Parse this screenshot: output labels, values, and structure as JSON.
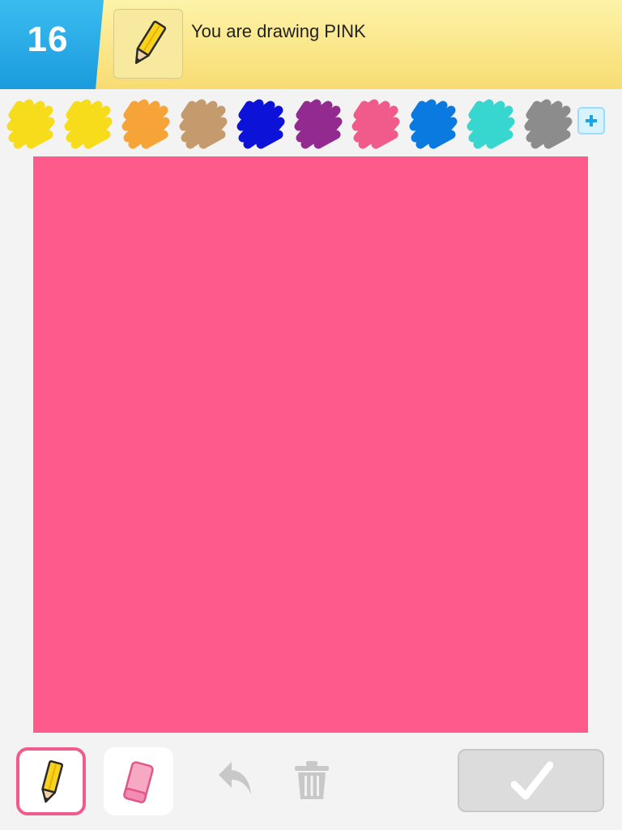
{
  "header": {
    "round_number": "16",
    "prompt": "You are drawing PINK",
    "badge_color": "#1ea6e4"
  },
  "palette": {
    "colors": [
      "#f7dc1b",
      "#f7dc1b",
      "#f6a437",
      "#c59a6d",
      "#0c12d7",
      "#922a8f",
      "#f15b8b",
      "#0a7ae1",
      "#37d6ce",
      "#8c8c8c"
    ],
    "add_icon": "plus-icon"
  },
  "canvas": {
    "fill_color": "#fe5a8c"
  },
  "toolbar": {
    "selected_tool": "pencil",
    "tools": [
      "pencil",
      "eraser",
      "undo",
      "trash"
    ],
    "done_icon": "checkmark-icon"
  }
}
